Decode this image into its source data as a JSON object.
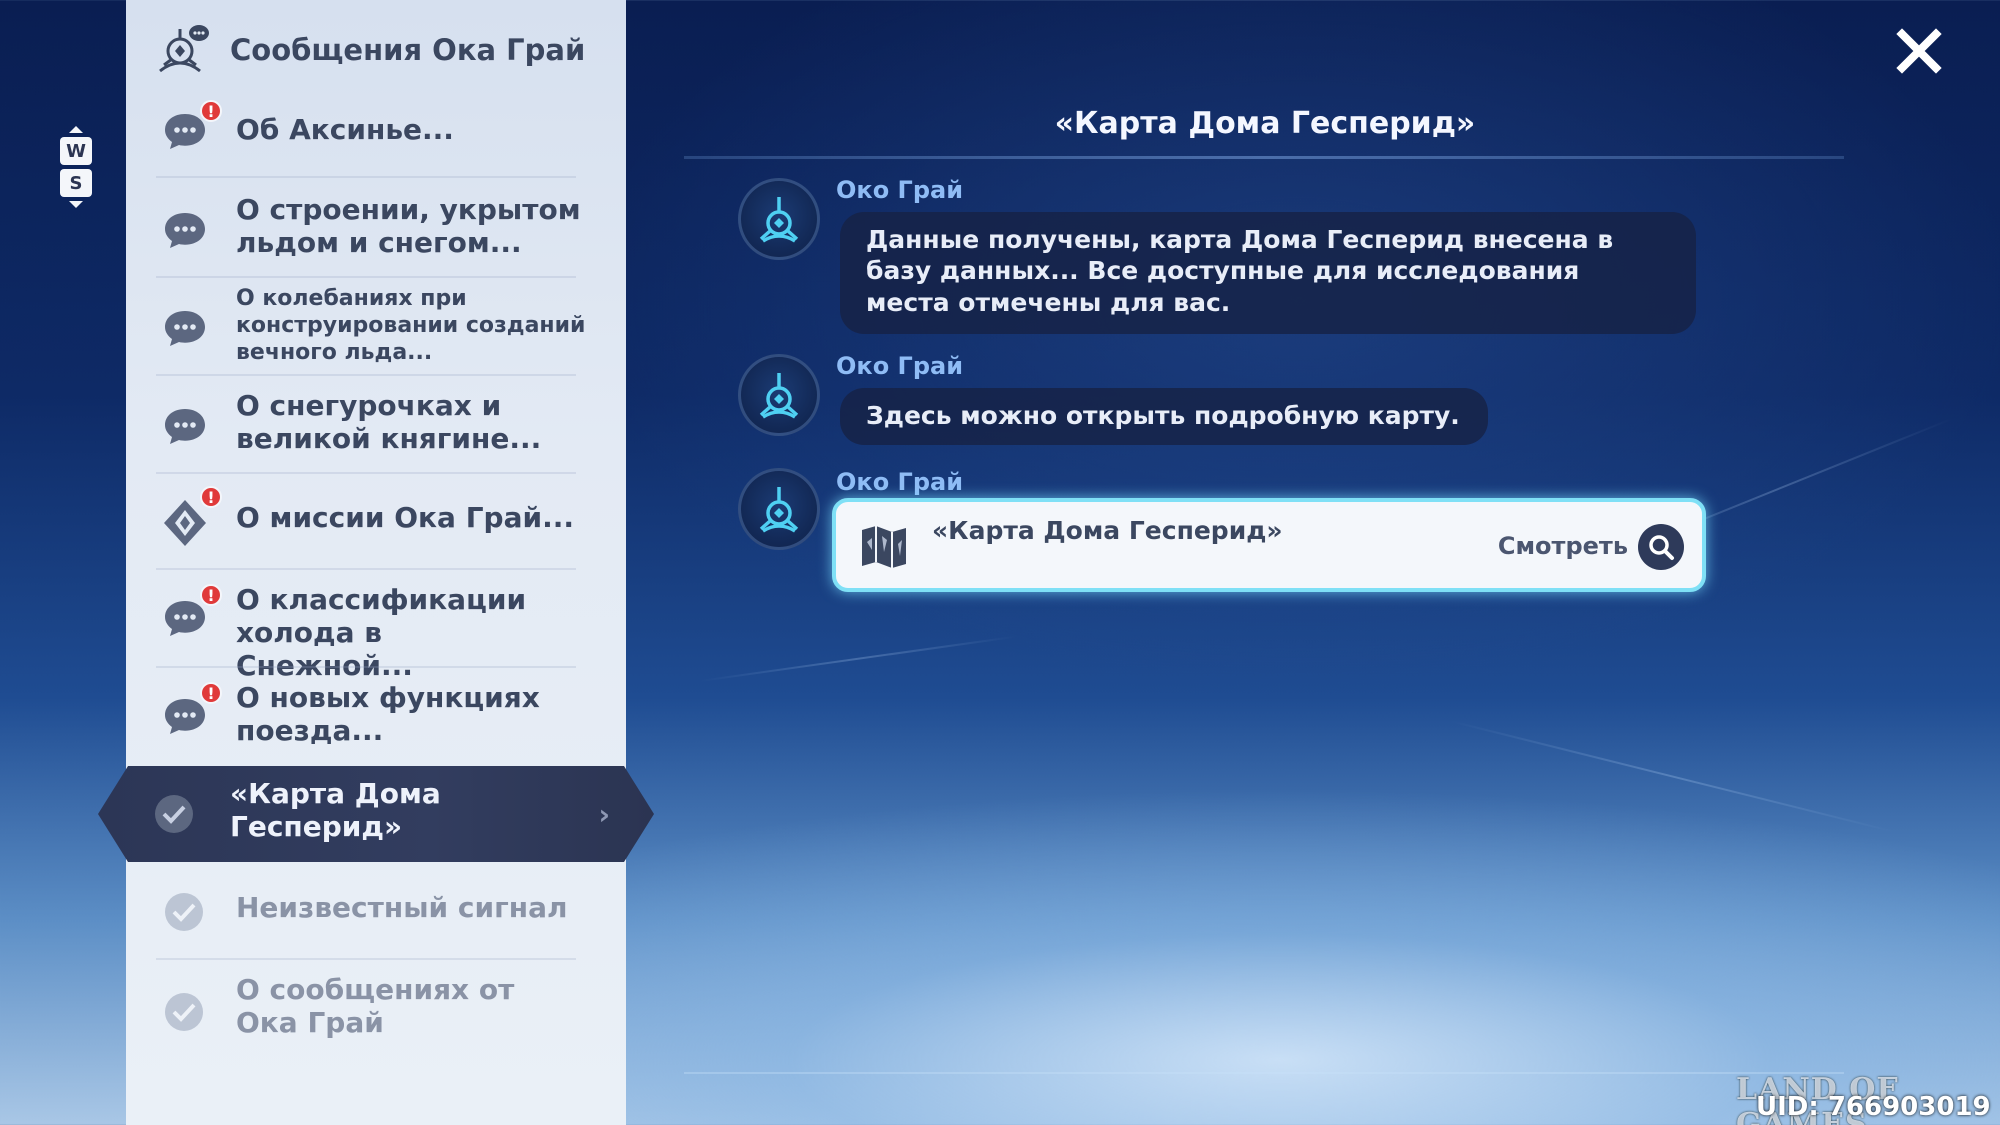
{
  "sidebar": {
    "header": {
      "label": "Сообщения Ока Грай",
      "icon": "oko-grai-chat-icon"
    },
    "items": [
      {
        "label": "Об Аксинье...",
        "icon": "chat-bubble-icon",
        "badge": "!",
        "status": "unread"
      },
      {
        "label": "О строении, укрытом льдом и снегом...",
        "icon": "chat-bubble-icon",
        "status": "read"
      },
      {
        "label": "О колебаниях при конструировании созданий вечного льда...",
        "icon": "chat-bubble-icon",
        "status": "read"
      },
      {
        "label": "О снегурочках и великой княгине...",
        "icon": "chat-bubble-icon",
        "status": "read"
      },
      {
        "label": "О миссии Ока Грай...",
        "icon": "mission-diamond-icon",
        "badge": "!",
        "status": "unread"
      },
      {
        "label": "О классификации холода в Снежной...",
        "icon": "chat-bubble-icon",
        "badge": "!",
        "status": "unread"
      },
      {
        "label": "О новых функциях поезда...",
        "icon": "chat-bubble-icon",
        "badge": "!",
        "status": "unread"
      },
      {
        "label": "«Карта Дома Гесперид»",
        "icon": "check-icon",
        "status": "selected"
      },
      {
        "label": "Неизвестный сигнал",
        "icon": "check-icon",
        "status": "done"
      },
      {
        "label": "О сообщениях от Ока Грай",
        "icon": "check-icon",
        "status": "done"
      }
    ]
  },
  "scroll_hint": {
    "up_key": "W",
    "down_key": "S"
  },
  "conversation": {
    "title": "«Карта Дома Гесперид»",
    "messages": [
      {
        "sender": "Око Грай",
        "text": "Данные получены, карта Дома Гесперид внесена в базу данных... Все доступные для исследования места отмечены для вас."
      },
      {
        "sender": "Око Грай",
        "text": "Здесь можно открыть подробную карту."
      },
      {
        "sender": "Око Грай",
        "card": {
          "title": "«Карта Дома Гесперид»",
          "action": "Смотреть",
          "icon": "map-icon",
          "action_icon": "search-icon"
        }
      }
    ]
  },
  "close_icon": "close-icon",
  "watermark": "LAND OF GAMES",
  "uid": "UID: 766903019",
  "colors": {
    "sidebar_bg": "#e3eaf4",
    "selected_bg": "#2c3656",
    "sender": "#8fbcf5",
    "card_glow": "#7fe0f6",
    "badge": "#e03a3a"
  }
}
